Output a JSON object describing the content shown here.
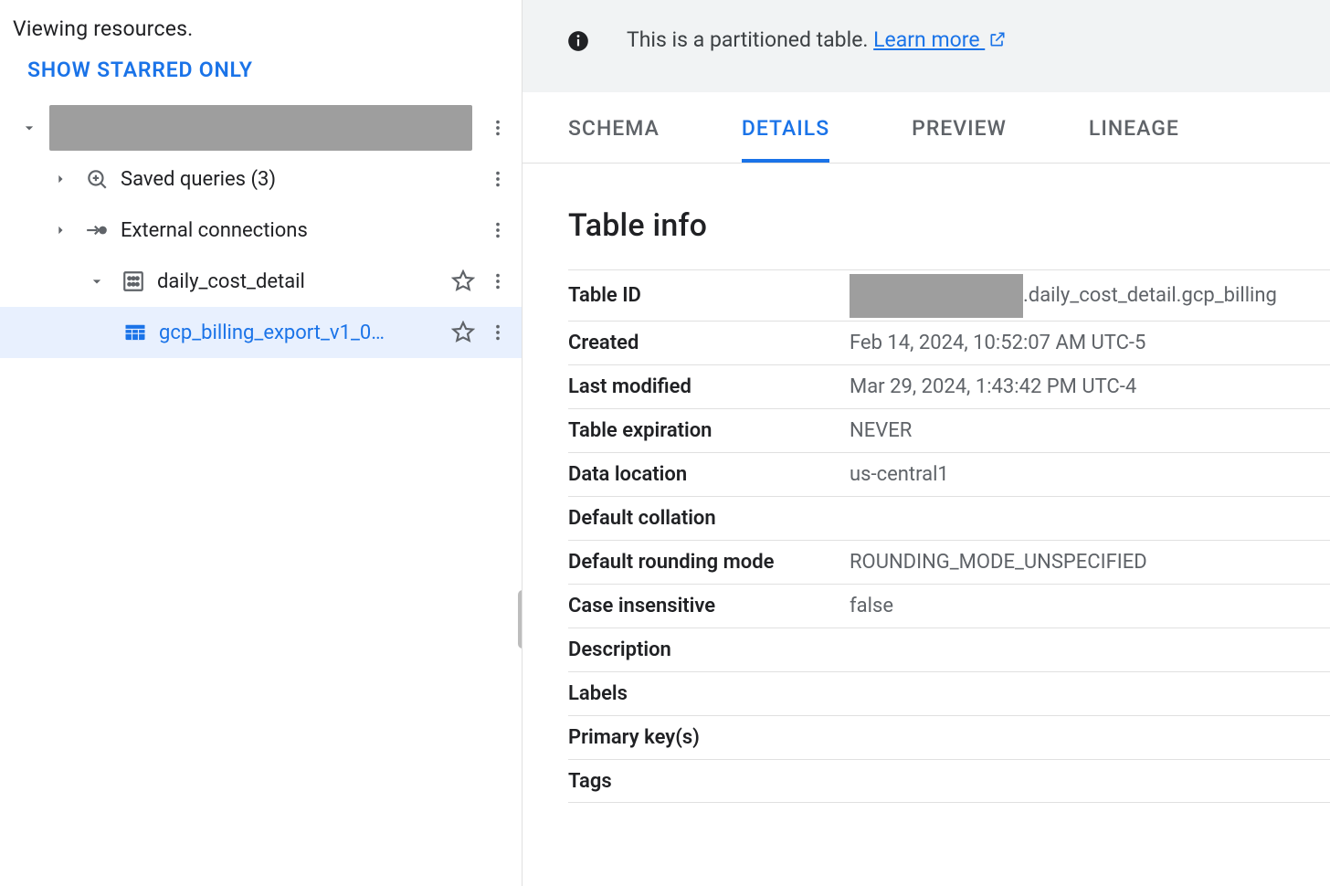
{
  "sidebar": {
    "status": "Viewing resources.",
    "show_starred": "SHOW STARRED ONLY",
    "items": {
      "saved_queries": "Saved queries (3)",
      "external_connections": "External connections",
      "dataset": "daily_cost_detail",
      "table": "gcp_billing_export_v1_0…"
    }
  },
  "banner": {
    "text": "This is a partitioned table. ",
    "link": "Learn more"
  },
  "tabs": {
    "schema": "SCHEMA",
    "details": "DETAILS",
    "preview": "PREVIEW",
    "lineage": "LINEAGE"
  },
  "section_heading": "Table info",
  "table_info": {
    "rows": [
      {
        "key": "Table ID",
        "value_suffix": ".daily_cost_detail.gcp_billing",
        "redacted_prefix": true
      },
      {
        "key": "Created",
        "value": "Feb 14, 2024, 10:52:07 AM UTC-5"
      },
      {
        "key": "Last modified",
        "value": "Mar 29, 2024, 1:43:42 PM UTC-4"
      },
      {
        "key": "Table expiration",
        "value": "NEVER"
      },
      {
        "key": "Data location",
        "value": "us-central1"
      },
      {
        "key": "Default collation",
        "value": ""
      },
      {
        "key": "Default rounding mode",
        "value": "ROUNDING_MODE_UNSPECIFIED"
      },
      {
        "key": "Case insensitive",
        "value": "false"
      },
      {
        "key": "Description",
        "value": ""
      },
      {
        "key": "Labels",
        "value": ""
      },
      {
        "key": "Primary key(s)",
        "value": ""
      },
      {
        "key": "Tags",
        "value": ""
      }
    ]
  }
}
